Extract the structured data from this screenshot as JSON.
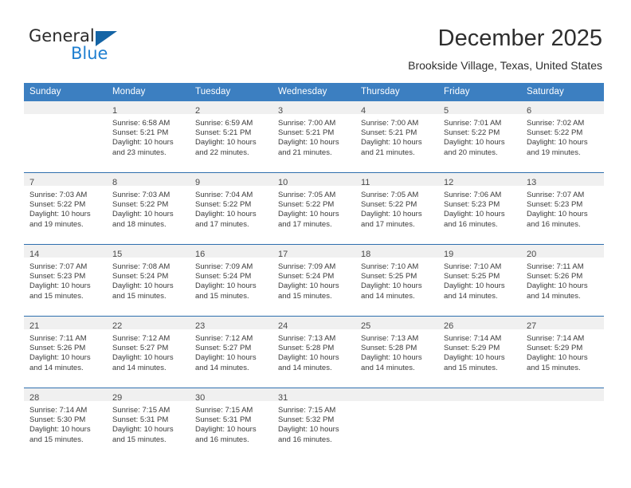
{
  "brand": {
    "name_part1": "General",
    "name_part2": "Blue",
    "accent_color": "#1464a5",
    "blue_text_color": "#1f7fd0"
  },
  "header": {
    "month_title": "December 2025",
    "location": "Brookside Village, Texas, United States"
  },
  "theme": {
    "header_blue": "#3c7fc1",
    "row_divider_blue": "#2f6fae",
    "daynum_band": "#f0f0f0"
  },
  "weekday_headers": [
    "Sunday",
    "Monday",
    "Tuesday",
    "Wednesday",
    "Thursday",
    "Friday",
    "Saturday"
  ],
  "weeks": [
    [
      {
        "day": "",
        "sunrise": "",
        "sunset": "",
        "daylight_line1": "",
        "daylight_line2": "",
        "empty": true
      },
      {
        "day": "1",
        "sunrise": "Sunrise: 6:58 AM",
        "sunset": "Sunset: 5:21 PM",
        "daylight_line1": "Daylight: 10 hours",
        "daylight_line2": "and 23 minutes."
      },
      {
        "day": "2",
        "sunrise": "Sunrise: 6:59 AM",
        "sunset": "Sunset: 5:21 PM",
        "daylight_line1": "Daylight: 10 hours",
        "daylight_line2": "and 22 minutes."
      },
      {
        "day": "3",
        "sunrise": "Sunrise: 7:00 AM",
        "sunset": "Sunset: 5:21 PM",
        "daylight_line1": "Daylight: 10 hours",
        "daylight_line2": "and 21 minutes."
      },
      {
        "day": "4",
        "sunrise": "Sunrise: 7:00 AM",
        "sunset": "Sunset: 5:21 PM",
        "daylight_line1": "Daylight: 10 hours",
        "daylight_line2": "and 21 minutes."
      },
      {
        "day": "5",
        "sunrise": "Sunrise: 7:01 AM",
        "sunset": "Sunset: 5:22 PM",
        "daylight_line1": "Daylight: 10 hours",
        "daylight_line2": "and 20 minutes."
      },
      {
        "day": "6",
        "sunrise": "Sunrise: 7:02 AM",
        "sunset": "Sunset: 5:22 PM",
        "daylight_line1": "Daylight: 10 hours",
        "daylight_line2": "and 19 minutes."
      }
    ],
    [
      {
        "day": "7",
        "sunrise": "Sunrise: 7:03 AM",
        "sunset": "Sunset: 5:22 PM",
        "daylight_line1": "Daylight: 10 hours",
        "daylight_line2": "and 19 minutes."
      },
      {
        "day": "8",
        "sunrise": "Sunrise: 7:03 AM",
        "sunset": "Sunset: 5:22 PM",
        "daylight_line1": "Daylight: 10 hours",
        "daylight_line2": "and 18 minutes."
      },
      {
        "day": "9",
        "sunrise": "Sunrise: 7:04 AM",
        "sunset": "Sunset: 5:22 PM",
        "daylight_line1": "Daylight: 10 hours",
        "daylight_line2": "and 17 minutes."
      },
      {
        "day": "10",
        "sunrise": "Sunrise: 7:05 AM",
        "sunset": "Sunset: 5:22 PM",
        "daylight_line1": "Daylight: 10 hours",
        "daylight_line2": "and 17 minutes."
      },
      {
        "day": "11",
        "sunrise": "Sunrise: 7:05 AM",
        "sunset": "Sunset: 5:22 PM",
        "daylight_line1": "Daylight: 10 hours",
        "daylight_line2": "and 17 minutes."
      },
      {
        "day": "12",
        "sunrise": "Sunrise: 7:06 AM",
        "sunset": "Sunset: 5:23 PM",
        "daylight_line1": "Daylight: 10 hours",
        "daylight_line2": "and 16 minutes."
      },
      {
        "day": "13",
        "sunrise": "Sunrise: 7:07 AM",
        "sunset": "Sunset: 5:23 PM",
        "daylight_line1": "Daylight: 10 hours",
        "daylight_line2": "and 16 minutes."
      }
    ],
    [
      {
        "day": "14",
        "sunrise": "Sunrise: 7:07 AM",
        "sunset": "Sunset: 5:23 PM",
        "daylight_line1": "Daylight: 10 hours",
        "daylight_line2": "and 15 minutes."
      },
      {
        "day": "15",
        "sunrise": "Sunrise: 7:08 AM",
        "sunset": "Sunset: 5:24 PM",
        "daylight_line1": "Daylight: 10 hours",
        "daylight_line2": "and 15 minutes."
      },
      {
        "day": "16",
        "sunrise": "Sunrise: 7:09 AM",
        "sunset": "Sunset: 5:24 PM",
        "daylight_line1": "Daylight: 10 hours",
        "daylight_line2": "and 15 minutes."
      },
      {
        "day": "17",
        "sunrise": "Sunrise: 7:09 AM",
        "sunset": "Sunset: 5:24 PM",
        "daylight_line1": "Daylight: 10 hours",
        "daylight_line2": "and 15 minutes."
      },
      {
        "day": "18",
        "sunrise": "Sunrise: 7:10 AM",
        "sunset": "Sunset: 5:25 PM",
        "daylight_line1": "Daylight: 10 hours",
        "daylight_line2": "and 14 minutes."
      },
      {
        "day": "19",
        "sunrise": "Sunrise: 7:10 AM",
        "sunset": "Sunset: 5:25 PM",
        "daylight_line1": "Daylight: 10 hours",
        "daylight_line2": "and 14 minutes."
      },
      {
        "day": "20",
        "sunrise": "Sunrise: 7:11 AM",
        "sunset": "Sunset: 5:26 PM",
        "daylight_line1": "Daylight: 10 hours",
        "daylight_line2": "and 14 minutes."
      }
    ],
    [
      {
        "day": "21",
        "sunrise": "Sunrise: 7:11 AM",
        "sunset": "Sunset: 5:26 PM",
        "daylight_line1": "Daylight: 10 hours",
        "daylight_line2": "and 14 minutes."
      },
      {
        "day": "22",
        "sunrise": "Sunrise: 7:12 AM",
        "sunset": "Sunset: 5:27 PM",
        "daylight_line1": "Daylight: 10 hours",
        "daylight_line2": "and 14 minutes."
      },
      {
        "day": "23",
        "sunrise": "Sunrise: 7:12 AM",
        "sunset": "Sunset: 5:27 PM",
        "daylight_line1": "Daylight: 10 hours",
        "daylight_line2": "and 14 minutes."
      },
      {
        "day": "24",
        "sunrise": "Sunrise: 7:13 AM",
        "sunset": "Sunset: 5:28 PM",
        "daylight_line1": "Daylight: 10 hours",
        "daylight_line2": "and 14 minutes."
      },
      {
        "day": "25",
        "sunrise": "Sunrise: 7:13 AM",
        "sunset": "Sunset: 5:28 PM",
        "daylight_line1": "Daylight: 10 hours",
        "daylight_line2": "and 14 minutes."
      },
      {
        "day": "26",
        "sunrise": "Sunrise: 7:14 AM",
        "sunset": "Sunset: 5:29 PM",
        "daylight_line1": "Daylight: 10 hours",
        "daylight_line2": "and 15 minutes."
      },
      {
        "day": "27",
        "sunrise": "Sunrise: 7:14 AM",
        "sunset": "Sunset: 5:29 PM",
        "daylight_line1": "Daylight: 10 hours",
        "daylight_line2": "and 15 minutes."
      }
    ],
    [
      {
        "day": "28",
        "sunrise": "Sunrise: 7:14 AM",
        "sunset": "Sunset: 5:30 PM",
        "daylight_line1": "Daylight: 10 hours",
        "daylight_line2": "and 15 minutes."
      },
      {
        "day": "29",
        "sunrise": "Sunrise: 7:15 AM",
        "sunset": "Sunset: 5:31 PM",
        "daylight_line1": "Daylight: 10 hours",
        "daylight_line2": "and 15 minutes."
      },
      {
        "day": "30",
        "sunrise": "Sunrise: 7:15 AM",
        "sunset": "Sunset: 5:31 PM",
        "daylight_line1": "Daylight: 10 hours",
        "daylight_line2": "and 16 minutes."
      },
      {
        "day": "31",
        "sunrise": "Sunrise: 7:15 AM",
        "sunset": "Sunset: 5:32 PM",
        "daylight_line1": "Daylight: 10 hours",
        "daylight_line2": "and 16 minutes."
      },
      {
        "day": "",
        "sunrise": "",
        "sunset": "",
        "daylight_line1": "",
        "daylight_line2": "",
        "empty": true
      },
      {
        "day": "",
        "sunrise": "",
        "sunset": "",
        "daylight_line1": "",
        "daylight_line2": "",
        "empty": true
      },
      {
        "day": "",
        "sunrise": "",
        "sunset": "",
        "daylight_line1": "",
        "daylight_line2": "",
        "empty": true
      }
    ]
  ]
}
